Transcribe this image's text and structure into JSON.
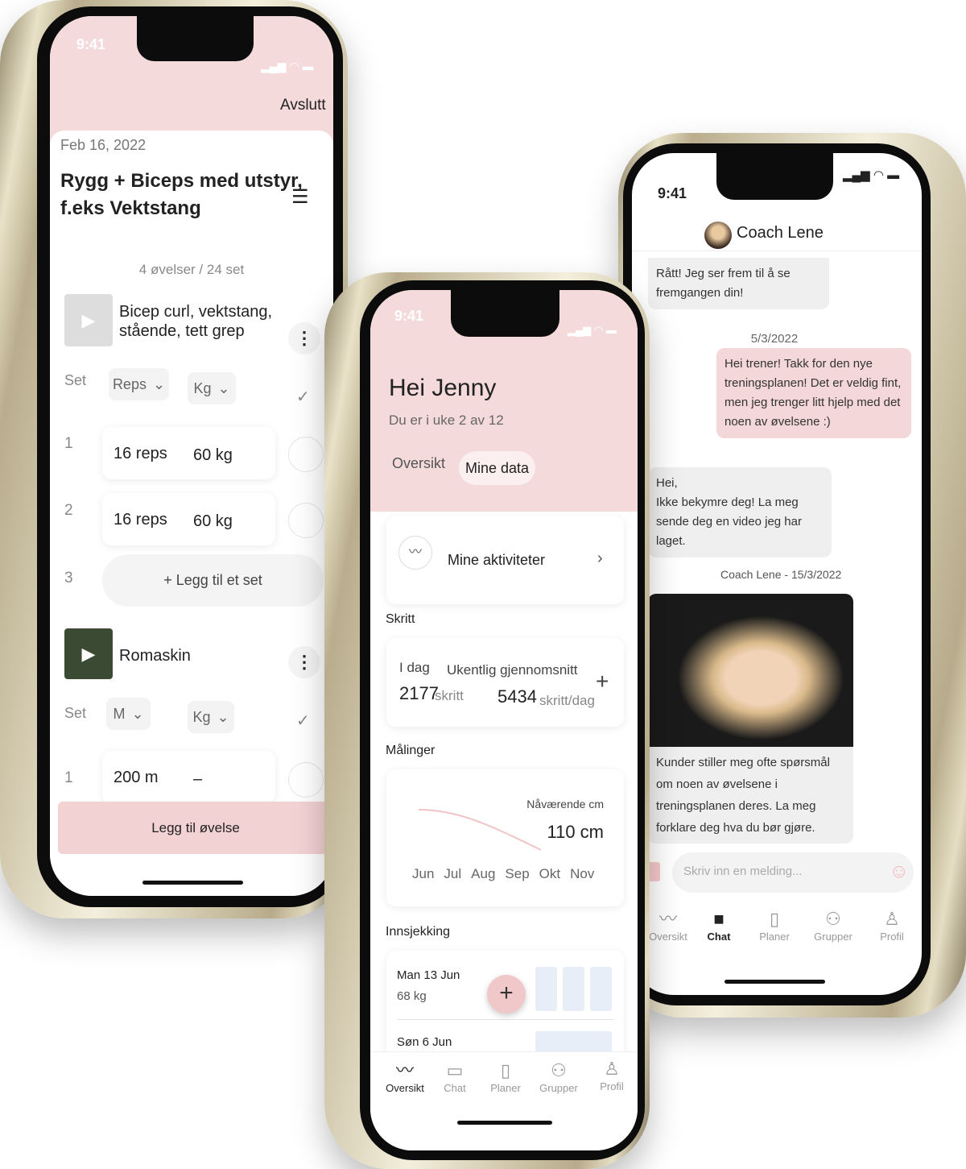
{
  "status": {
    "time": "9:41"
  },
  "workout": {
    "finish": "Avslutt",
    "date": "Feb 16, 2022",
    "title_line1": "Rygg + Biceps med utstyr,",
    "title_line2": "f.eks Vektstang",
    "summary": "4 øvelser / 24 set",
    "exercises": [
      {
        "name_line1": "Bicep curl, vektstang,",
        "name_line2": "stående, tett grep",
        "col_set": "Set",
        "col_a": "Reps",
        "col_b": "Kg",
        "rows": [
          {
            "n": "1",
            "a": "16 reps",
            "b": "60 kg"
          },
          {
            "n": "2",
            "a": "16 reps",
            "b": "60 kg"
          }
        ],
        "next_n": "3",
        "add_set": "+ Legg til et set"
      },
      {
        "name": "Romaskin",
        "col_set": "Set",
        "col_a": "M",
        "col_b": "Kg",
        "rows": [
          {
            "n": "1",
            "a": "200 m",
            "b": "–"
          }
        ]
      }
    ],
    "add_exercise": "Legg til øvelse"
  },
  "overview": {
    "greeting": "Hei Jenny",
    "subtitle": "Du er i uke 2 av 12",
    "tabs": [
      "Oversikt",
      "Mine data"
    ],
    "active_tab": "Mine data",
    "activities": "Mine aktiviteter",
    "steps_title": "Skritt",
    "today_label": "I dag",
    "weekly_label": "Ukentlig gjennomsnitt",
    "today_value": "2177",
    "today_unit": "skritt",
    "weekly_value": "5434",
    "weekly_unit": "skritt/dag",
    "measure_title": "Målinger",
    "current_label": "Nåværende cm",
    "current_value": "110 cm",
    "months": [
      "Jun",
      "Jul",
      "Aug",
      "Sep",
      "Okt",
      "Nov"
    ],
    "checkin_title": "Innsjekking",
    "checkins": [
      {
        "date": "Man 13 Jun",
        "weight": "68 kg"
      },
      {
        "date": "Søn 6 Jun"
      }
    ]
  },
  "nav": {
    "items": [
      "Oversikt",
      "Chat",
      "Planer",
      "Grupper",
      "Profil"
    ]
  },
  "chat": {
    "coach": "Coach Lene",
    "messages": [
      {
        "text": "Rått! Jeg ser frem til å se fremgangen din!"
      },
      {
        "date": "5/3/2022"
      },
      {
        "text": "Hei trener! Takk for den nye treningsplanen! Det er veldig fint, men jeg trenger litt hjelp med det noen av øvelsene :)"
      },
      {
        "text": "Hei,\nIkke bekymre deg! La meg sende deg en video jeg har laget."
      },
      {
        "meta": "Coach Lene - 15/3/2022"
      },
      {
        "text": "Kunder stiller meg ofte spørsmål om noen av øvelsene i treningsplanen deres. La meg forklare deg hva du bør gjøre."
      }
    ],
    "placeholder": "Skriv inn en melding..."
  },
  "colors": {
    "accent": "#f4dadb",
    "fab": "#f0c8ca",
    "checkin_box": "#e8eef8",
    "frame": "#d8cfb2"
  }
}
